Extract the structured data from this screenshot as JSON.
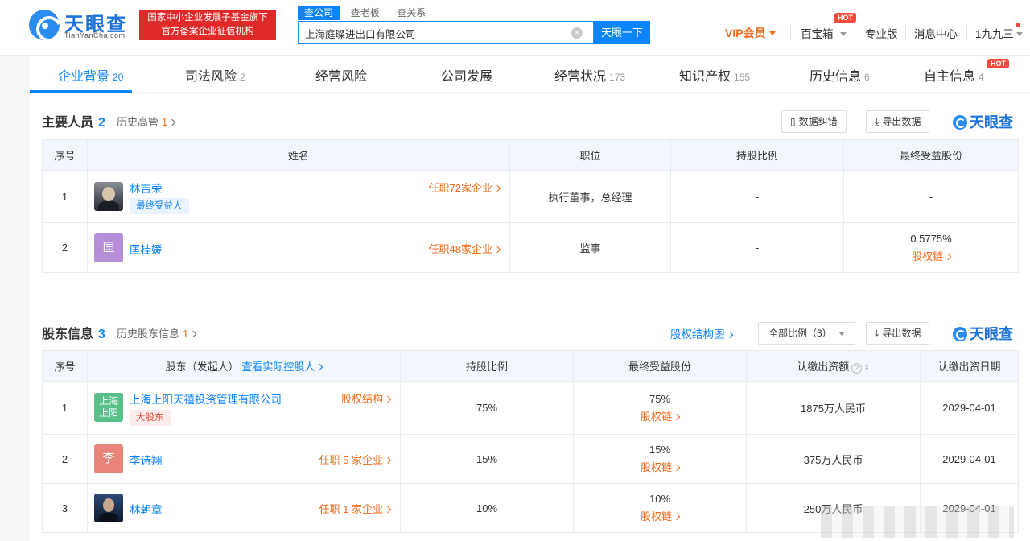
{
  "header": {
    "logo_text": "天眼查",
    "logo_sub": "TianYanCha.com",
    "badge_line1": "国家中小企业发展子基金旗下",
    "badge_line2": "官方备案企业征信机构",
    "search_tabs": [
      "查公司",
      "查老板",
      "查关系"
    ],
    "search_value": "上海庭璨进出口有限公司",
    "search_button": "天眼一下",
    "vip": "VIP会员",
    "baibaoxiang": "百宝箱",
    "hot": "HOT",
    "pro": "专业版",
    "messages": "消息中心",
    "user": "1九九三"
  },
  "company_tabs": [
    {
      "label": "企业背景",
      "count": "20"
    },
    {
      "label": "司法风险",
      "count": "2"
    },
    {
      "label": "经营风险",
      "count": ""
    },
    {
      "label": "公司发展",
      "count": ""
    },
    {
      "label": "经营状况",
      "count": "173"
    },
    {
      "label": "知识产权",
      "count": "155"
    },
    {
      "label": "历史信息",
      "count": "6"
    },
    {
      "label": "自主信息",
      "count": "4"
    }
  ],
  "personnel": {
    "title": "主要人员",
    "count": "2",
    "history_label": "历史高管",
    "history_count": "1",
    "btn_correct": "数据纠错",
    "btn_export": "导出数据",
    "brand": "天眼查",
    "columns": [
      "序号",
      "姓名",
      "职位",
      "持股比例",
      "最终受益股份"
    ],
    "rows": [
      {
        "no": "1",
        "name": "林吉荣",
        "tag": "最终受益人",
        "jobs": "任职72家企业",
        "position": "执行董事，总经理",
        "ratio": "-",
        "benefit": "-",
        "benefit_link": ""
      },
      {
        "no": "2",
        "name": "匡桂媛",
        "avatar_char": "匡",
        "jobs": "任职48家企业",
        "position": "监事",
        "ratio": "-",
        "benefit": "0.5775%",
        "benefit_link": "股权链"
      }
    ]
  },
  "shareholders": {
    "title": "股东信息",
    "count": "3",
    "history_label": "历史股东信息",
    "history_count": "1",
    "structure_link": "股权结构图",
    "filter": "全部比例（3）",
    "btn_export": "导出数据",
    "brand": "天眼查",
    "columns": {
      "no": "序号",
      "holder": "股东（发起人）",
      "holder_link": "查看实际控股人",
      "ratio": "持股比例",
      "benefit": "最终受益股份",
      "capital": "认缴出资额",
      "date": "认缴出资日期"
    },
    "rows": [
      {
        "no": "1",
        "name": "上海上阳天禧投资管理有限公司",
        "avatar_text": "上海上阳",
        "tag": "大股东",
        "link": "股权结构",
        "ratio": "75%",
        "benefit": "75%",
        "benefit_link": "股权链",
        "capital": "1875万人民币",
        "date": "2029-04-01"
      },
      {
        "no": "2",
        "name": "李诗翔",
        "avatar_char": "李",
        "link": "任职 5 家企业",
        "ratio": "15%",
        "benefit": "15%",
        "benefit_link": "股权链",
        "capital": "375万人民币",
        "date": "2029-04-01"
      },
      {
        "no": "3",
        "name": "林朝章",
        "link": "任职 1 家企业",
        "ratio": "10%",
        "benefit": "10%",
        "benefit_link": "股权链",
        "capital": "250万人民币",
        "date": "2029-04-01"
      }
    ]
  },
  "colors": {
    "accent": "#0c84ff",
    "orange": "#f06a1a",
    "red": "#e02a2a",
    "header_bg": "#f2f7fd"
  }
}
